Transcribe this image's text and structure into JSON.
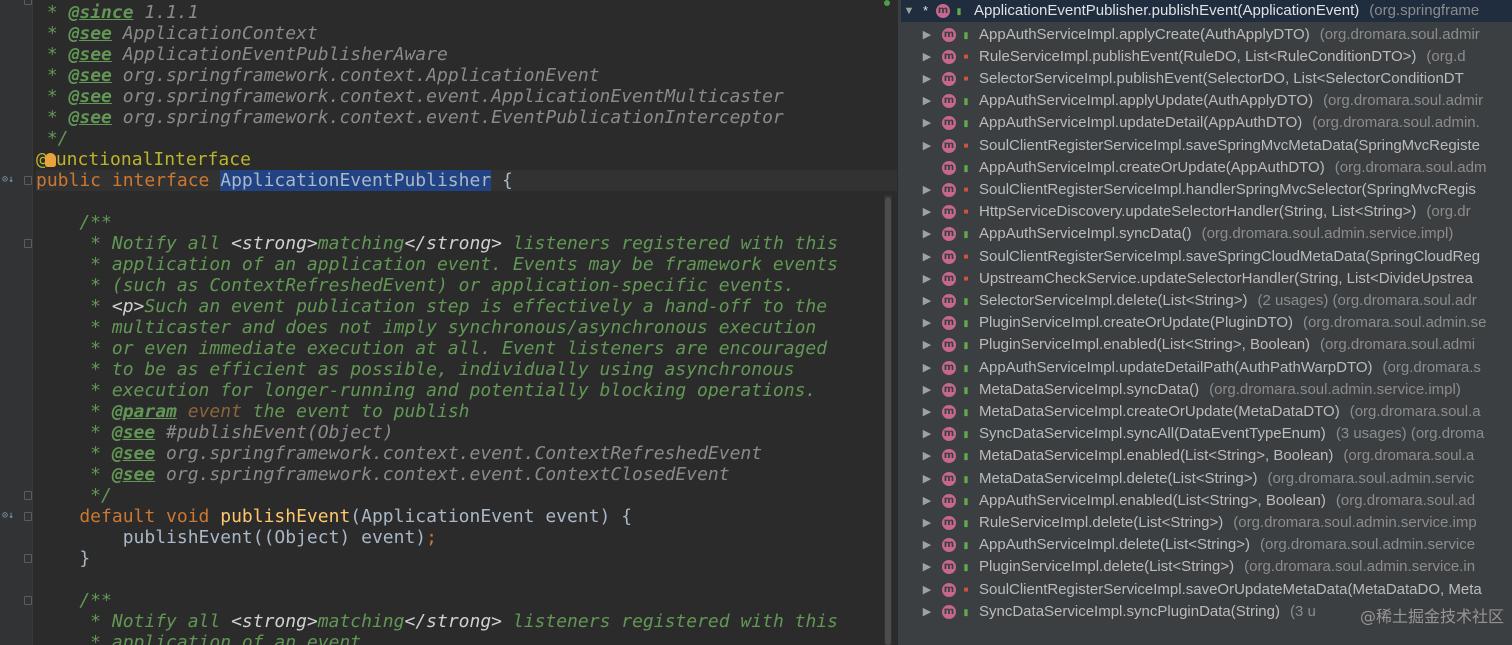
{
  "editor": {
    "lines": [
      [
        {
          "c": "doc",
          "t": " * "
        },
        {
          "c": "doctag",
          "t": "@since"
        },
        {
          "c": "docref",
          "t": " 1.1.1"
        }
      ],
      [
        {
          "c": "doc",
          "t": " * "
        },
        {
          "c": "doctag",
          "t": "@see"
        },
        {
          "c": "docref",
          "t": " ApplicationContext"
        }
      ],
      [
        {
          "c": "doc",
          "t": " * "
        },
        {
          "c": "doctag",
          "t": "@see"
        },
        {
          "c": "docref",
          "t": " ApplicationEventPublisherAware"
        }
      ],
      [
        {
          "c": "doc",
          "t": " * "
        },
        {
          "c": "doctag",
          "t": "@see"
        },
        {
          "c": "docref",
          "t": " org.springframework.context.ApplicationEvent"
        }
      ],
      [
        {
          "c": "doc",
          "t": " * "
        },
        {
          "c": "doctag",
          "t": "@see"
        },
        {
          "c": "docref",
          "t": " org.springframework.context.event.ApplicationEventMulticaster"
        }
      ],
      [
        {
          "c": "doc",
          "t": " * "
        },
        {
          "c": "doctag",
          "t": "@see"
        },
        {
          "c": "docref",
          "t": " org.springframework.context.event.EventPublicationInterceptor"
        }
      ],
      [
        {
          "c": "doc",
          "t": " */"
        }
      ],
      [
        {
          "c": "ann",
          "t": "@"
        },
        {
          "c": "bulb",
          "t": ""
        },
        {
          "c": "ann",
          "t": "unctionalInterface"
        }
      ],
      [
        {
          "c": "kw",
          "t": "public interface "
        },
        {
          "c": "cls-hl",
          "t": "ApplicationEventPublisher"
        },
        {
          "c": "ident",
          "t": " {"
        }
      ],
      [
        {
          "c": "ident",
          "t": ""
        }
      ],
      [
        {
          "c": "doc",
          "t": "    /**"
        }
      ],
      [
        {
          "c": "doc",
          "t": "     * Notify all "
        },
        {
          "c": "htmltag",
          "t": "<strong>"
        },
        {
          "c": "doc",
          "t": "matching"
        },
        {
          "c": "htmltag",
          "t": "</strong>"
        },
        {
          "c": "doc",
          "t": " listeners registered with this"
        }
      ],
      [
        {
          "c": "doc",
          "t": "     * application of an application event. Events may be framework events"
        }
      ],
      [
        {
          "c": "doc",
          "t": "     * (such as ContextRefreshedEvent) or application-specific events."
        }
      ],
      [
        {
          "c": "doc",
          "t": "     * "
        },
        {
          "c": "htmltag",
          "t": "<p>"
        },
        {
          "c": "doc",
          "t": "Such an event publication step is effectively a hand-off to the"
        }
      ],
      [
        {
          "c": "doc",
          "t": "     * multicaster and does not imply synchronous/asynchronous execution"
        }
      ],
      [
        {
          "c": "doc",
          "t": "     * or even immediate execution at all. Event listeners are encouraged"
        }
      ],
      [
        {
          "c": "doc",
          "t": "     * to be as efficient as possible, individually using asynchronous"
        }
      ],
      [
        {
          "c": "doc",
          "t": "     * execution for longer-running and potentially blocking operations."
        }
      ],
      [
        {
          "c": "doc",
          "t": "     * "
        },
        {
          "c": "doctag",
          "t": "@param"
        },
        {
          "c": "docparam",
          "t": " event"
        },
        {
          "c": "doc",
          "t": " the event to publish"
        }
      ],
      [
        {
          "c": "doc",
          "t": "     * "
        },
        {
          "c": "doctag",
          "t": "@see"
        },
        {
          "c": "docref",
          "t": " #publishEvent(Object)"
        }
      ],
      [
        {
          "c": "doc",
          "t": "     * "
        },
        {
          "c": "doctag",
          "t": "@see"
        },
        {
          "c": "docref",
          "t": " org.springframework.context.event.ContextRefreshedEvent"
        }
      ],
      [
        {
          "c": "doc",
          "t": "     * "
        },
        {
          "c": "doctag",
          "t": "@see"
        },
        {
          "c": "docref",
          "t": " org.springframework.context.event.ContextClosedEvent"
        }
      ],
      [
        {
          "c": "doc",
          "t": "     */"
        }
      ],
      [
        {
          "c": "kw",
          "t": "    default void "
        },
        {
          "c": "fn",
          "t": "publishEvent"
        },
        {
          "c": "ident",
          "t": "(ApplicationEvent event) {"
        }
      ],
      [
        {
          "c": "ident",
          "t": "        publishEvent((Object) event)"
        },
        {
          "c": "kw",
          "t": ";"
        }
      ],
      [
        {
          "c": "ident",
          "t": "    }"
        }
      ],
      [
        {
          "c": "ident",
          "t": ""
        }
      ],
      [
        {
          "c": "doc",
          "t": "    /**"
        }
      ],
      [
        {
          "c": "doc",
          "t": "     * Notify all "
        },
        {
          "c": "htmltag",
          "t": "<strong>"
        },
        {
          "c": "doc",
          "t": "matching"
        },
        {
          "c": "htmltag",
          "t": "</strong>"
        },
        {
          "c": "doc",
          "t": " listeners registered with this"
        }
      ],
      [
        {
          "c": "doc",
          "t": "     * application of an event."
        }
      ]
    ]
  },
  "hierarchy": {
    "root": {
      "star": "*",
      "marker": "m",
      "method": "ApplicationEventPublisher.publishEvent(ApplicationEvent)",
      "package": "(org.springframe"
    },
    "items": [
      {
        "method": "AppAuthServiceImpl.applyCreate(AuthApplyDTO)",
        "package": "(org.dromara.soul.admir",
        "vis": "pub",
        "arrow": "▶"
      },
      {
        "method": "RuleServiceImpl.publishEvent(RuleDO, List<RuleConditionDTO>)",
        "package": "(org.d",
        "vis": "lock",
        "arrow": "▶"
      },
      {
        "method": "SelectorServiceImpl.publishEvent(SelectorDO, List<SelectorConditionDT",
        "package": "",
        "vis": "lock",
        "arrow": "▶"
      },
      {
        "method": "AppAuthServiceImpl.applyUpdate(AuthApplyDTO)",
        "package": "(org.dromara.soul.admir",
        "vis": "pub",
        "arrow": "▶"
      },
      {
        "method": "AppAuthServiceImpl.updateDetail(AppAuthDTO)",
        "package": "(org.dromara.soul.admin.",
        "vis": "pub",
        "arrow": "▶"
      },
      {
        "method": "SoulClientRegisterServiceImpl.saveSpringMvcMetaData(SpringMvcRegiste",
        "package": "",
        "vis": "lock",
        "arrow": "▶"
      },
      {
        "method": "AppAuthServiceImpl.createOrUpdate(AppAuthDTO)",
        "package": "(org.dromara.soul.adm",
        "vis": "pub",
        "arrow": ""
      },
      {
        "method": "SoulClientRegisterServiceImpl.handlerSpringMvcSelector(SpringMvcRegis",
        "package": "",
        "vis": "lock",
        "arrow": "▶"
      },
      {
        "method": "HttpServiceDiscovery.updateSelectorHandler(String, List<String>)",
        "package": "(org.dr",
        "vis": "lock",
        "arrow": "▶"
      },
      {
        "method": "AppAuthServiceImpl.syncData()",
        "package": "(org.dromara.soul.admin.service.impl)",
        "vis": "pub",
        "arrow": "▶"
      },
      {
        "method": "SoulClientRegisterServiceImpl.saveSpringCloudMetaData(SpringCloudReg",
        "package": "",
        "vis": "lock",
        "arrow": "▶"
      },
      {
        "method": "UpstreamCheckService.updateSelectorHandler(String, List<DivideUpstrea",
        "package": "",
        "vis": "lock",
        "arrow": "▶"
      },
      {
        "method": "SelectorServiceImpl.delete(List<String>)",
        "package": "(2 usages)  (org.dromara.soul.adr",
        "vis": "pub",
        "arrow": "▶"
      },
      {
        "method": "PluginServiceImpl.createOrUpdate(PluginDTO)",
        "package": "(org.dromara.soul.admin.se",
        "vis": "pub",
        "arrow": "▶"
      },
      {
        "method": "PluginServiceImpl.enabled(List<String>, Boolean)",
        "package": "(org.dromara.soul.admi",
        "vis": "pub",
        "arrow": "▶"
      },
      {
        "method": "AppAuthServiceImpl.updateDetailPath(AuthPathWarpDTO)",
        "package": "(org.dromara.s",
        "vis": "pub",
        "arrow": "▶"
      },
      {
        "method": "MetaDataServiceImpl.syncData()",
        "package": "(org.dromara.soul.admin.service.impl)",
        "vis": "pub",
        "arrow": "▶"
      },
      {
        "method": "MetaDataServiceImpl.createOrUpdate(MetaDataDTO)",
        "package": "(org.dromara.soul.a",
        "vis": "pub",
        "arrow": "▶"
      },
      {
        "method": "SyncDataServiceImpl.syncAll(DataEventTypeEnum)",
        "package": "(3 usages)  (org.droma",
        "vis": "pub",
        "arrow": "▶"
      },
      {
        "method": "MetaDataServiceImpl.enabled(List<String>, Boolean)",
        "package": "(org.dromara.soul.a",
        "vis": "pub",
        "arrow": "▶"
      },
      {
        "method": "MetaDataServiceImpl.delete(List<String>)",
        "package": "(org.dromara.soul.admin.servic",
        "vis": "pub",
        "arrow": "▶"
      },
      {
        "method": "AppAuthServiceImpl.enabled(List<String>, Boolean)",
        "package": "(org.dromara.soul.ad",
        "vis": "pub",
        "arrow": "▶"
      },
      {
        "method": "RuleServiceImpl.delete(List<String>)",
        "package": "(org.dromara.soul.admin.service.imp",
        "vis": "pub",
        "arrow": "▶"
      },
      {
        "method": "AppAuthServiceImpl.delete(List<String>)",
        "package": "(org.dromara.soul.admin.service",
        "vis": "pub",
        "arrow": "▶"
      },
      {
        "method": "PluginServiceImpl.delete(List<String>)",
        "package": "(org.dromara.soul.admin.service.in",
        "vis": "pub",
        "arrow": "▶"
      },
      {
        "method": "SoulClientRegisterServiceImpl.saveOrUpdateMetaData(MetaDataDO, Meta",
        "package": "",
        "vis": "lock",
        "arrow": "▶"
      },
      {
        "method": "SyncDataServiceImpl.syncPluginData(String)",
        "package": "(3 u",
        "vis": "pub",
        "arrow": "▶"
      }
    ],
    "watermark": "@稀土掘金技术社区"
  },
  "colors": {
    "editor_bg": "#2b2b2b",
    "panel_bg": "#3c3f41",
    "selected_row": "#1f2d3f",
    "method_marker": "#c7678d"
  }
}
